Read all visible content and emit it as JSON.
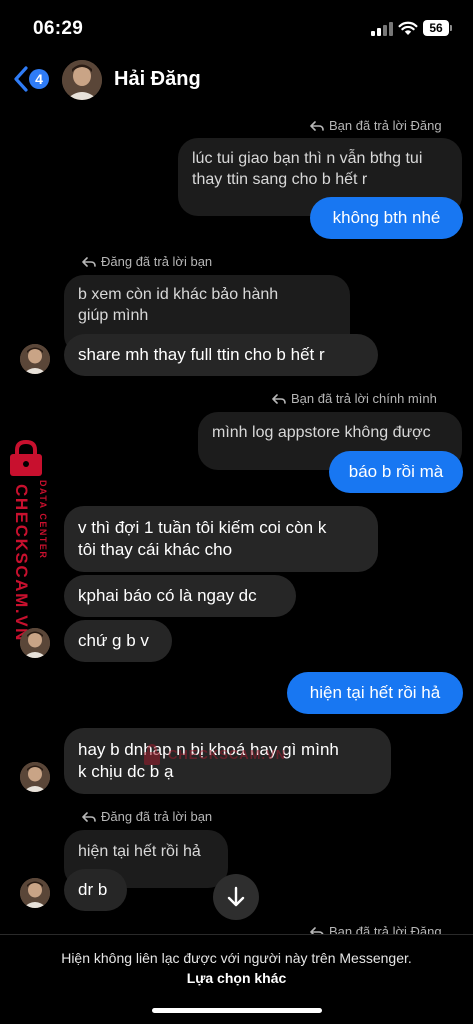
{
  "status_bar": {
    "time": "06:29",
    "battery": "56"
  },
  "header": {
    "back_badge": "4",
    "contact_name": "Hải Đăng"
  },
  "messages": {
    "reply_note_1": "Bạn đã trả lời Đăng",
    "quoted_1_line1": "lúc tui giao bạn thì n vẫn bthg tui",
    "quoted_1_line2": "thay ttin sang cho b hết r",
    "sent_1": "không bth nhé",
    "reply_note_2": "Đăng đã trả lời bạn",
    "quoted_2_line1": "b xem còn id khác bảo hành",
    "quoted_2_line2": "giúp mình",
    "received_1": "share mh thay full ttin cho b hết r",
    "reply_note_3": "Bạn đã trả lời chính mình",
    "quoted_3": "mình log appstore không được",
    "sent_2": "báo b rồi mà",
    "received_2_line1": "v thì đợi 1 tuần tôi kiếm coi còn k",
    "received_2_line2": "tôi thay cái khác cho",
    "received_3": "kphai báo có là ngay dc",
    "received_4": "chứ g b v",
    "sent_3": "hiện tại hết rồi hả",
    "received_5_line1": "hay b dnhap n bị khoá hay gì mình",
    "received_5_line2": "k chịu dc b ạ",
    "reply_note_4": "Đăng đã trả lời bạn",
    "quoted_4": "hiện tại hết rồi hả",
    "received_6": "dr b",
    "reply_note_5": "Bạn đã trả lời Đăng"
  },
  "watermark": {
    "side_label_1": "DATA CENTER",
    "side_label_2": "CHECKSCAM.VN",
    "center_label": "CHECKSCAM.VN"
  },
  "footer": {
    "notice": "Hiện không liên lạc được với người này trên Messenger.",
    "option_link": "Lựa chọn khác"
  },
  "colors": {
    "sent_bubble": "#1877f2",
    "received_bubble": "#262626",
    "background": "#000000",
    "badge": "#2f7cf6",
    "watermark": "#c8102e"
  },
  "icons": {
    "back": "chevron-left-icon",
    "reply": "reply-arrow-icon",
    "scroll": "arrow-down-icon",
    "wifi": "wifi-icon",
    "signal": "cellular-signal-icon",
    "lock": "lock-icon"
  }
}
